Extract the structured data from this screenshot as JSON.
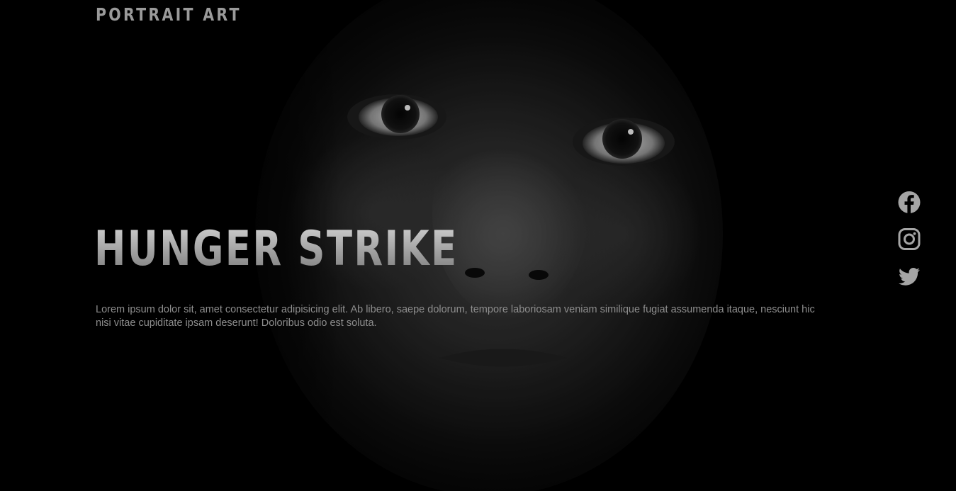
{
  "site": {
    "logo": "PORTRAIT ART"
  },
  "hero": {
    "title": "HUNGER STRIKE",
    "description": "Lorem ipsum dolor sit, amet consectetur adipisicing elit. Ab libero, saepe dolorum, tempore laboriosam veniam similique fugiat assumenda itaque, nesciunt hic nisi vitae cupiditate ipsam deserunt! Doloribus odio est soluta."
  },
  "social": [
    {
      "icon": "facebook-icon"
    },
    {
      "icon": "instagram-icon"
    },
    {
      "icon": "twitter-icon"
    }
  ],
  "colors": {
    "background": "#000000",
    "text_muted": "#8e8e8e",
    "icon": "#a5a5a5"
  }
}
